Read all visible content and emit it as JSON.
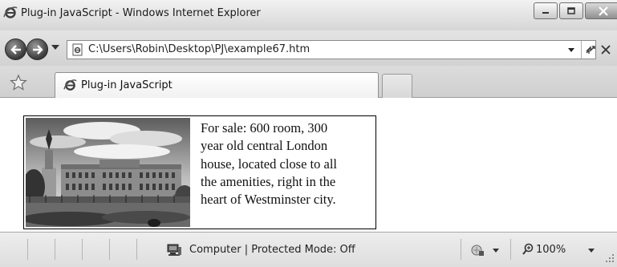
{
  "window": {
    "title": "Plug-in JavaScript - Windows Internet Explorer"
  },
  "address": {
    "url": "C:\\Users\\Robin\\Desktop\\PJ\\example67.htm"
  },
  "tabs": [
    {
      "label": "Plug-in JavaScript"
    }
  ],
  "content": {
    "listing_lines": [
      "For sale: 600 room, 300",
      "year old central London",
      "house, located close to all",
      "the amenities, right in the",
      "heart of Westminster city."
    ]
  },
  "status": {
    "zone": "Computer | Protected Mode: Off",
    "zoom": "100%"
  },
  "icons": {
    "ie": "ie-logo-icon",
    "back": "back-arrow-icon",
    "forward": "forward-arrow-icon",
    "page": "page-icon",
    "refresh": "refresh-icon",
    "stop": "stop-icon",
    "favorites": "favorites-star-icon",
    "zone": "computer-zone-icon",
    "security": "security-icon",
    "zoom": "zoom-icon"
  },
  "colors": {
    "chrome_light": "#f2f2f2",
    "chrome_dark": "#d6d6d6",
    "nav_button": "#3a3a3a",
    "content_background": "#ffffff"
  }
}
